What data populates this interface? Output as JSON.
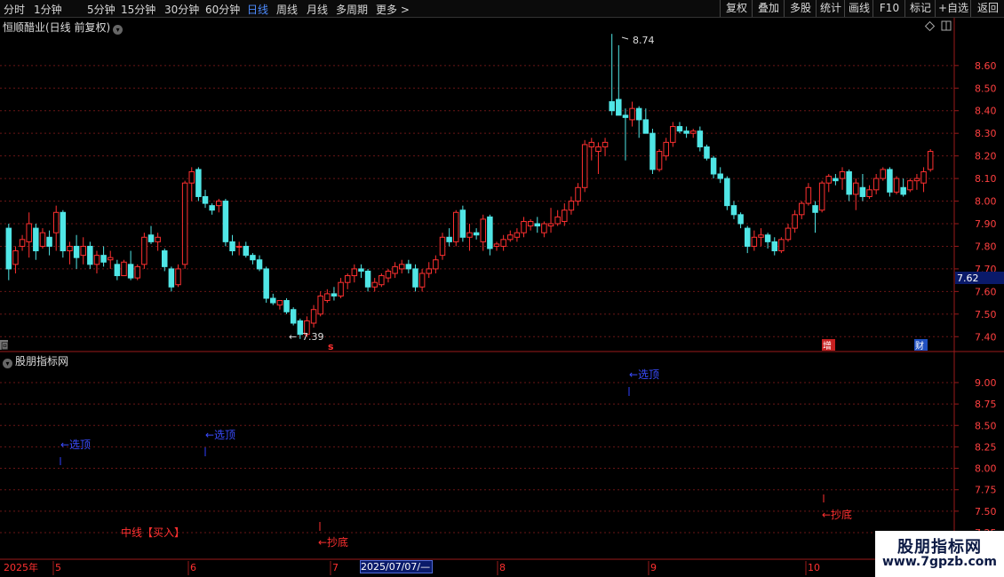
{
  "toolbar": {
    "periods": [
      "分时",
      "1分钟",
      "5分钟",
      "15分钟",
      "30分钟",
      "60分钟",
      "日线",
      "周线",
      "月线",
      "多周期",
      "更多"
    ],
    "active": "日线",
    "right": [
      "复权",
      "叠加",
      "多股",
      "统计",
      "画线",
      "F10",
      "标记",
      "+自选",
      "返回"
    ]
  },
  "main": {
    "title": "恒顺醋业(日线 前复权)",
    "high_label": "8.74",
    "low_label": "7.39",
    "current_price": "7.62",
    "markers": {
      "left": "回",
      "s": "s",
      "zeng": "增",
      "cai": "财"
    }
  },
  "sub": {
    "title": "股朋指标网",
    "labels": {
      "xuanding": "←选顶",
      "chaodi": "←抄底",
      "zhongxian": "中线【买入】"
    }
  },
  "dates": {
    "year": "2025年",
    "months": [
      "5",
      "6",
      "7",
      "8",
      "9",
      "10"
    ],
    "cursor": "2025/07/07/—"
  },
  "watermark": {
    "title": "股朋指标网",
    "url": "www.7gpzb.com"
  },
  "colors": {
    "up": "#ff3030",
    "down": "#50e6e6",
    "grid": "#701818",
    "accent": "#4e8cff"
  },
  "chart_data": {
    "type": "candlestick",
    "ohlc": [
      [
        7.88,
        7.9,
        7.65,
        7.7
      ],
      [
        7.72,
        7.8,
        7.68,
        7.78
      ],
      [
        7.8,
        7.85,
        7.78,
        7.83
      ],
      [
        7.82,
        7.95,
        7.75,
        7.9
      ],
      [
        7.88,
        7.9,
        7.74,
        7.78
      ],
      [
        7.8,
        7.88,
        7.79,
        7.86
      ],
      [
        7.84,
        7.87,
        7.76,
        7.8
      ],
      [
        7.86,
        7.98,
        7.78,
        7.95
      ],
      [
        7.95,
        7.96,
        7.75,
        7.78
      ],
      [
        7.78,
        7.82,
        7.72,
        7.8
      ],
      [
        7.8,
        7.85,
        7.7,
        7.75
      ],
      [
        7.76,
        7.84,
        7.72,
        7.8
      ],
      [
        7.8,
        7.82,
        7.7,
        7.72
      ],
      [
        7.72,
        7.78,
        7.68,
        7.76
      ],
      [
        7.76,
        7.8,
        7.71,
        7.73
      ],
      [
        7.74,
        7.78,
        7.7,
        7.75
      ],
      [
        7.72,
        7.74,
        7.65,
        7.67
      ],
      [
        7.67,
        7.74,
        7.67,
        7.73
      ],
      [
        7.72,
        7.78,
        7.65,
        7.66
      ],
      [
        7.66,
        7.72,
        7.65,
        7.71
      ],
      [
        7.72,
        7.86,
        7.7,
        7.84
      ],
      [
        7.85,
        7.89,
        7.81,
        7.82
      ],
      [
        7.82,
        7.86,
        7.78,
        7.84
      ],
      [
        7.78,
        7.79,
        7.69,
        7.71
      ],
      [
        7.7,
        7.71,
        7.6,
        7.62
      ],
      [
        7.63,
        7.72,
        7.62,
        7.7
      ],
      [
        7.72,
        8.09,
        7.7,
        8.08
      ],
      [
        8.08,
        8.15,
        8.0,
        8.13
      ],
      [
        8.14,
        8.15,
        8.0,
        8.02
      ],
      [
        8.02,
        8.05,
        7.97,
        7.99
      ],
      [
        7.98,
        7.99,
        7.94,
        7.96
      ],
      [
        7.98,
        8.01,
        7.95,
        8.0
      ],
      [
        8.0,
        8.01,
        7.8,
        7.82
      ],
      [
        7.82,
        7.85,
        7.76,
        7.78
      ],
      [
        7.8,
        7.82,
        7.76,
        7.8
      ],
      [
        7.8,
        7.82,
        7.75,
        7.76
      ],
      [
        7.76,
        7.77,
        7.72,
        7.74
      ],
      [
        7.74,
        7.76,
        7.69,
        7.7
      ],
      [
        7.7,
        7.71,
        7.55,
        7.57
      ],
      [
        7.57,
        7.59,
        7.54,
        7.55
      ],
      [
        7.54,
        7.56,
        7.52,
        7.56
      ],
      [
        7.56,
        7.57,
        7.5,
        7.51
      ],
      [
        7.52,
        7.53,
        7.45,
        7.46
      ],
      [
        7.47,
        7.48,
        7.39,
        7.41
      ],
      [
        7.41,
        7.49,
        7.4,
        7.47
      ],
      [
        7.46,
        7.54,
        7.44,
        7.52
      ],
      [
        7.5,
        7.6,
        7.49,
        7.58
      ],
      [
        7.56,
        7.61,
        7.55,
        7.59
      ],
      [
        7.59,
        7.62,
        7.56,
        7.58
      ],
      [
        7.58,
        7.66,
        7.57,
        7.64
      ],
      [
        7.64,
        7.68,
        7.61,
        7.67
      ],
      [
        7.67,
        7.72,
        7.64,
        7.7
      ],
      [
        7.7,
        7.72,
        7.66,
        7.69
      ],
      [
        7.69,
        7.7,
        7.6,
        7.62
      ],
      [
        7.62,
        7.66,
        7.6,
        7.64
      ],
      [
        7.63,
        7.68,
        7.62,
        7.67
      ],
      [
        7.66,
        7.7,
        7.64,
        7.69
      ],
      [
        7.68,
        7.73,
        7.66,
        7.71
      ],
      [
        7.7,
        7.74,
        7.68,
        7.72
      ],
      [
        7.72,
        7.74,
        7.68,
        7.7
      ],
      [
        7.7,
        7.72,
        7.6,
        7.62
      ],
      [
        7.62,
        7.7,
        7.6,
        7.68
      ],
      [
        7.68,
        7.73,
        7.66,
        7.7
      ],
      [
        7.7,
        7.76,
        7.68,
        7.74
      ],
      [
        7.76,
        7.86,
        7.74,
        7.84
      ],
      [
        7.84,
        7.88,
        7.8,
        7.82
      ],
      [
        7.82,
        7.96,
        7.8,
        7.95
      ],
      [
        7.96,
        7.98,
        7.82,
        7.84
      ],
      [
        7.84,
        7.9,
        7.78,
        7.86
      ],
      [
        7.86,
        7.88,
        7.83,
        7.85
      ],
      [
        7.82,
        7.94,
        7.78,
        7.92
      ],
      [
        7.93,
        7.94,
        7.76,
        7.79
      ],
      [
        7.8,
        7.82,
        7.78,
        7.81
      ],
      [
        7.8,
        7.85,
        7.78,
        7.83
      ],
      [
        7.83,
        7.87,
        7.82,
        7.85
      ],
      [
        7.84,
        7.88,
        7.82,
        7.86
      ],
      [
        7.86,
        7.93,
        7.84,
        7.91
      ],
      [
        7.89,
        7.92,
        7.87,
        7.91
      ],
      [
        7.9,
        7.93,
        7.86,
        7.89
      ],
      [
        7.86,
        7.91,
        7.84,
        7.9
      ],
      [
        7.89,
        7.97,
        7.86,
        7.9
      ],
      [
        7.9,
        7.96,
        7.89,
        7.93
      ],
      [
        7.91,
        7.99,
        7.89,
        7.96
      ],
      [
        7.96,
        8.02,
        7.94,
        8.0
      ],
      [
        8.0,
        8.08,
        7.98,
        8.06
      ],
      [
        8.06,
        8.27,
        8.04,
        8.25
      ],
      [
        8.24,
        8.28,
        8.18,
        8.26
      ],
      [
        8.22,
        8.26,
        8.12,
        8.24
      ],
      [
        8.24,
        8.28,
        8.2,
        8.26
      ],
      [
        8.44,
        8.74,
        8.38,
        8.4
      ],
      [
        8.45,
        8.69,
        8.38,
        8.38
      ],
      [
        8.38,
        8.41,
        8.18,
        8.37
      ],
      [
        8.36,
        8.44,
        8.33,
        8.41
      ],
      [
        8.41,
        8.42,
        8.28,
        8.36
      ],
      [
        8.36,
        8.41,
        8.3,
        8.3
      ],
      [
        8.3,
        8.32,
        8.12,
        8.14
      ],
      [
        8.14,
        8.23,
        8.13,
        8.22
      ],
      [
        8.2,
        8.28,
        8.18,
        8.26
      ],
      [
        8.26,
        8.35,
        8.24,
        8.33
      ],
      [
        8.33,
        8.35,
        8.3,
        8.31
      ],
      [
        8.31,
        8.33,
        8.28,
        8.3
      ],
      [
        8.3,
        8.32,
        8.28,
        8.31
      ],
      [
        8.31,
        8.33,
        8.22,
        8.24
      ],
      [
        8.24,
        8.25,
        8.18,
        8.19
      ],
      [
        8.19,
        8.2,
        8.1,
        8.12
      ],
      [
        8.12,
        8.15,
        8.08,
        8.1
      ],
      [
        8.1,
        8.11,
        7.96,
        7.98
      ],
      [
        7.98,
        8.0,
        7.92,
        7.94
      ],
      [
        7.94,
        7.95,
        7.88,
        7.9
      ],
      [
        7.88,
        7.89,
        7.77,
        7.8
      ],
      [
        7.8,
        7.87,
        7.78,
        7.84
      ],
      [
        7.84,
        7.88,
        7.8,
        7.85
      ],
      [
        7.85,
        7.86,
        7.79,
        7.82
      ],
      [
        7.82,
        7.84,
        7.76,
        7.78
      ],
      [
        7.78,
        7.84,
        7.77,
        7.83
      ],
      [
        7.83,
        7.9,
        7.82,
        7.88
      ],
      [
        7.88,
        7.96,
        7.86,
        7.94
      ],
      [
        7.94,
        8.0,
        7.92,
        7.99
      ],
      [
        7.99,
        8.08,
        7.98,
        8.06
      ],
      [
        7.98,
        8.0,
        7.86,
        7.95
      ],
      [
        7.96,
        8.09,
        7.95,
        8.08
      ],
      [
        8.08,
        8.12,
        8.04,
        8.11
      ],
      [
        8.1,
        8.12,
        8.07,
        8.09
      ],
      [
        8.1,
        8.15,
        8.05,
        8.13
      ],
      [
        8.13,
        8.14,
        8.0,
        8.03
      ],
      [
        8.03,
        8.1,
        7.96,
        8.08
      ],
      [
        8.06,
        8.12,
        8.0,
        8.02
      ],
      [
        8.02,
        8.07,
        8.01,
        8.05
      ],
      [
        8.05,
        8.12,
        8.03,
        8.1
      ],
      [
        8.1,
        8.15,
        8.09,
        8.14
      ],
      [
        8.14,
        8.15,
        8.02,
        8.04
      ],
      [
        8.04,
        8.11,
        8.03,
        8.1
      ],
      [
        8.06,
        8.1,
        8.02,
        8.03
      ],
      [
        8.05,
        8.1,
        8.04,
        8.09
      ],
      [
        8.09,
        8.12,
        8.05,
        8.1
      ],
      [
        8.08,
        8.15,
        8.04,
        8.13
      ],
      [
        8.14,
        8.23,
        8.13,
        8.22
      ]
    ],
    "y_ticks_main": [
      "8.60",
      "8.50",
      "8.40",
      "8.30",
      "8.20",
      "8.10",
      "8.00",
      "7.90",
      "7.80",
      "7.70",
      "7.60",
      "7.50",
      "7.40"
    ],
    "y_ticks_sub": [
      "9.00",
      "8.75",
      "8.50",
      "8.25",
      "8.00",
      "7.75",
      "7.50",
      "7.25"
    ],
    "ylim_main": [
      7.35,
      8.78
    ],
    "ylim_sub": [
      7.25,
      9.3
    ]
  }
}
